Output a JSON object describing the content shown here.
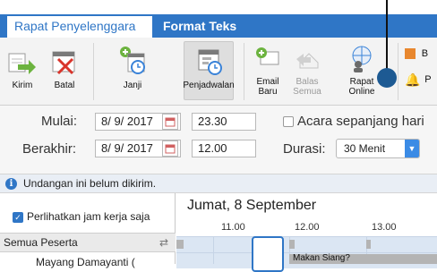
{
  "tabs": [
    {
      "label": "Rapat Penyelenggara",
      "active": true
    },
    {
      "label": "Format Teks",
      "active": false
    }
  ],
  "ribbon": {
    "buttons": [
      {
        "label": "Kirim",
        "icon": "send-icon"
      },
      {
        "label": "Batal",
        "icon": "cancel-meeting-icon"
      },
      {
        "label": "Janji",
        "icon": "appointment-icon"
      },
      {
        "label": "Penjadwalan",
        "icon": "scheduling-icon",
        "selected": true
      },
      {
        "label_line1": "Email",
        "label_line2": "Baru",
        "icon": "new-email-icon"
      },
      {
        "label_line1": "Balas",
        "label_line2": "Semua",
        "icon": "reply-all-icon",
        "disabled": true
      },
      {
        "label_line1": "Rapat",
        "label_line2": "Online",
        "icon": "online-meeting-icon"
      },
      {
        "label": "B",
        "icon": "busy-status-icon"
      },
      {
        "label": "P",
        "icon": "reminder-bell-icon"
      }
    ]
  },
  "form": {
    "start_label": "Mulai:",
    "start_date": "8/ 9/ 2017",
    "start_time": "23.30",
    "end_label": "Berakhir:",
    "end_date": "8/ 9/ 2017",
    "end_time": "12.00",
    "all_day_label": "Acara sepanjang hari",
    "all_day_checked": false,
    "duration_label": "Durasi:",
    "duration_value": "30 Menit"
  },
  "info_bar": {
    "text": "Undangan ini belum dikirim."
  },
  "scheduling": {
    "show_work_hours_label": "Perlihatkan jam kerja saja",
    "show_work_hours_checked": true,
    "attendees_header": "Semua Peserta",
    "attendee_partial": "Mayang Damayanti (",
    "day_title": "Jumat, 8 September",
    "hours": [
      "11.00",
      "12.00",
      "13.00"
    ],
    "event_label": "Makan Siang?"
  },
  "colors": {
    "accent": "#2f76c6",
    "callout": "#1d5a93",
    "grid_fill": "#dbe6f3"
  }
}
